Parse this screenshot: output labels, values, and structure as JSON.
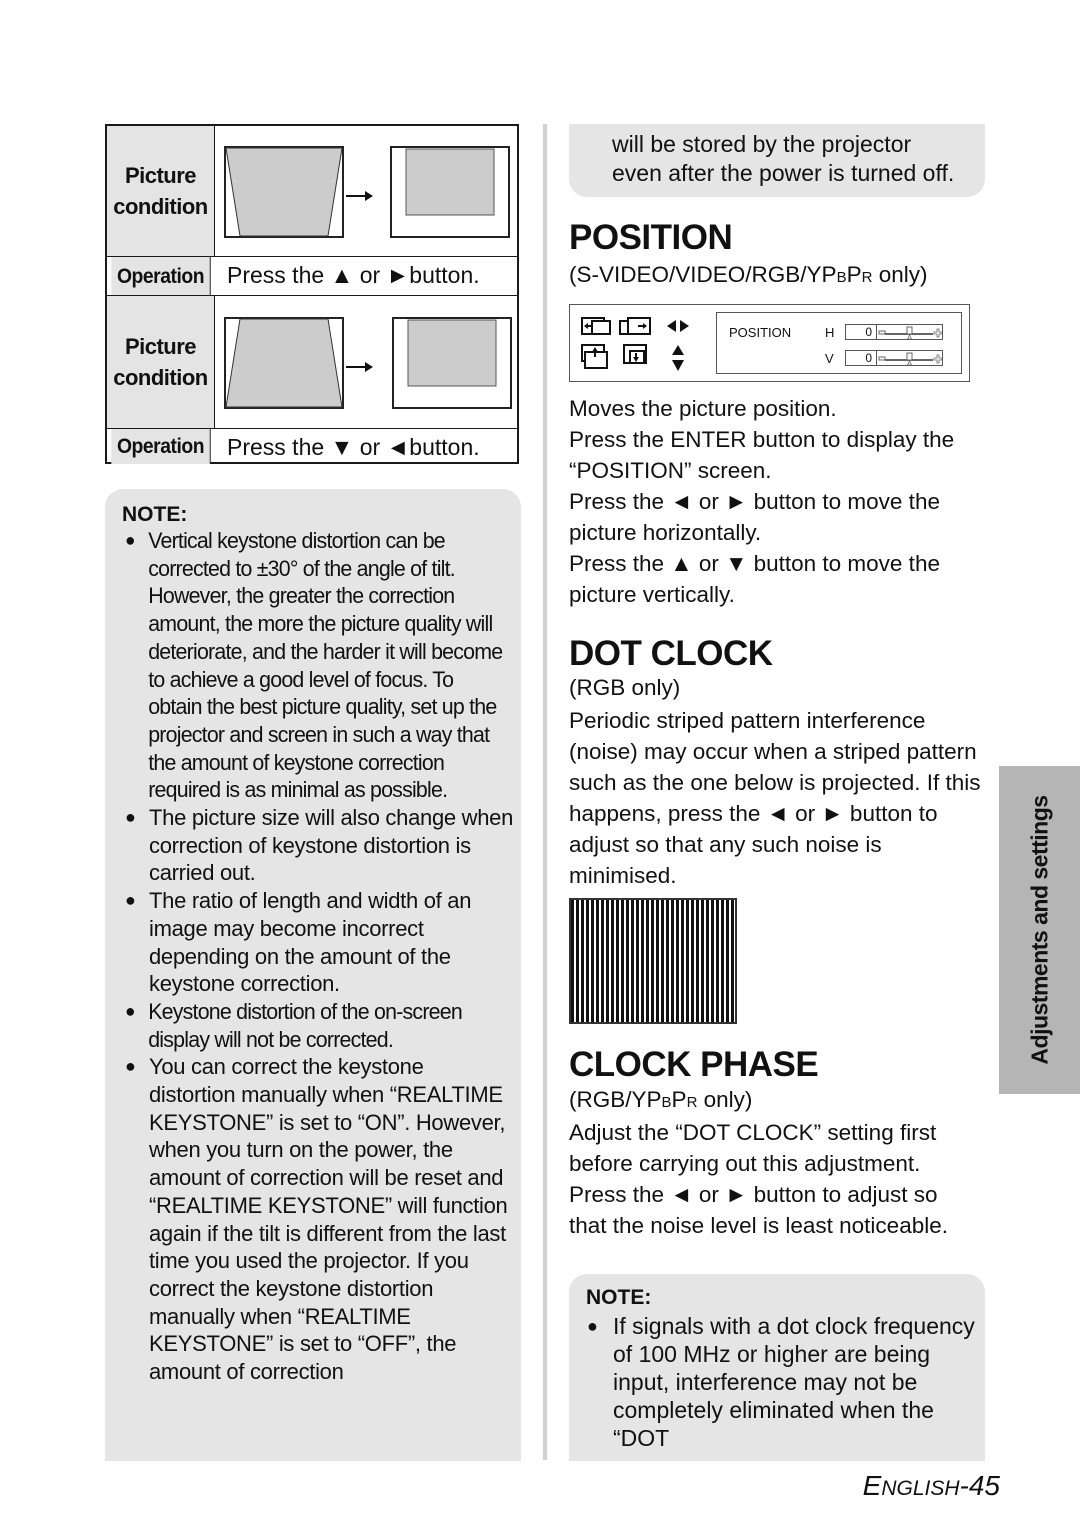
{
  "keystone_table": {
    "rows": [
      {
        "label_line1": "Picture",
        "label_line2": "condition",
        "arrow": "→"
      },
      {
        "label": "Operation",
        "text": "Press the ▲ or ►button."
      },
      {
        "label_line1": "Picture",
        "label_line2": "condition",
        "arrow": "→"
      },
      {
        "label": "Operation",
        "text": "Press the ▼ or ◄button."
      }
    ]
  },
  "note_left": {
    "title": "NOTE:",
    "bullet": "●",
    "items": [
      "Vertical keystone distortion can be corrected to ±30° of the angle of tilt. However, the greater the correction amount, the more the picture quality will deteriorate, and the harder it will become to achieve a good level of focus. To obtain the best picture quality, set up the projector and screen in such a way that the amount of keystone correction required is as minimal as possible.",
      "The picture size will also change when correction of keystone distortion is carried out.",
      "The ratio of length and width of an image may become incorrect depending on the amount of the keystone correction.",
      "Keystone distortion of the on-screen display will not be corrected.",
      "You can correct the keystone distortion manually when “REALTIME KEYSTONE” is set to “ON”. However, when you turn on the power, the amount of correction will be reset and “REALTIME KEYSTONE” will function again if the tilt is different from the last time you used the projector. If you correct the keystone distortion manually when “REALTIME KEYSTONE” is set to “OFF”, the amount of correction"
    ]
  },
  "note_top_right": {
    "line1": "will be stored by the projector",
    "line2": "even after the power is turned off."
  },
  "position": {
    "title": "POSITION",
    "sub_prefix": "(S-VIDEO/VIDEO/RGB/YP",
    "sub_b": "B",
    "sub_p": "P",
    "sub_r": "R",
    "sub_suffix": " only)",
    "osd": {
      "label": "POSITION",
      "rows": [
        {
          "axis": "H",
          "value": "0"
        },
        {
          "axis": "V",
          "value": "0"
        }
      ]
    },
    "paragraphs": [
      "Moves the picture position.",
      "Press the ENTER button to display the “POSITION” screen.",
      "Press the ◄ or ► button to move the picture horizontally.",
      "Press the ▲ or ▼ button to move the picture vertically."
    ]
  },
  "dot_clock": {
    "title": "DOT CLOCK",
    "sub": "(RGB only)",
    "paragraph": "Periodic striped pattern interference (noise) may occur when a striped pattern such as the one below is projected. If this happens, press the ◄ or ► button to adjust so that any such noise is minimised."
  },
  "clock_phase": {
    "title": "CLOCK PHASE",
    "sub_prefix": "(RGB/YP",
    "sub_b": "B",
    "sub_p": "P",
    "sub_r": "R",
    "sub_suffix": " only)",
    "paragraph": "Adjust the “DOT CLOCK” setting first before carrying out this adjustment. Press the ◄ or ► button to adjust so that the noise level is least noticeable."
  },
  "note_bottom_right": {
    "title": "NOTE:",
    "bullet": "●",
    "items": [
      "If signals with a dot clock frequency of 100 MHz or higher are being input, interference may not be completely eliminated when the “DOT"
    ]
  },
  "side_tab": "Adjustments and settings",
  "page_number": {
    "E": "E",
    "rest": "NGLISH",
    "num": "-45"
  }
}
